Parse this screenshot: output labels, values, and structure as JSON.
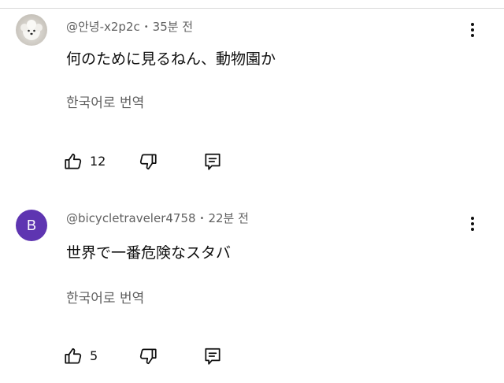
{
  "comments": [
    {
      "author": "@안녕-x2p2c",
      "time": "35분 전",
      "text": "何のために見るねん、動物園か",
      "translate_label": "한국어로 번역",
      "likes": "12",
      "avatar_type": "photo"
    },
    {
      "author": "@bicycletraveler4758",
      "time": "22분 전",
      "text": "世界で一番危険なスタバ",
      "translate_label": "한국어로 번역",
      "likes": "5",
      "avatar_type": "letter",
      "avatar_letter": "B",
      "avatar_color": "#5e35b1"
    }
  ],
  "separator": "•",
  "icons": {
    "like": "thumb-up-icon",
    "dislike": "thumb-down-icon",
    "reply": "reply-icon",
    "menu": "more-vert-icon"
  }
}
